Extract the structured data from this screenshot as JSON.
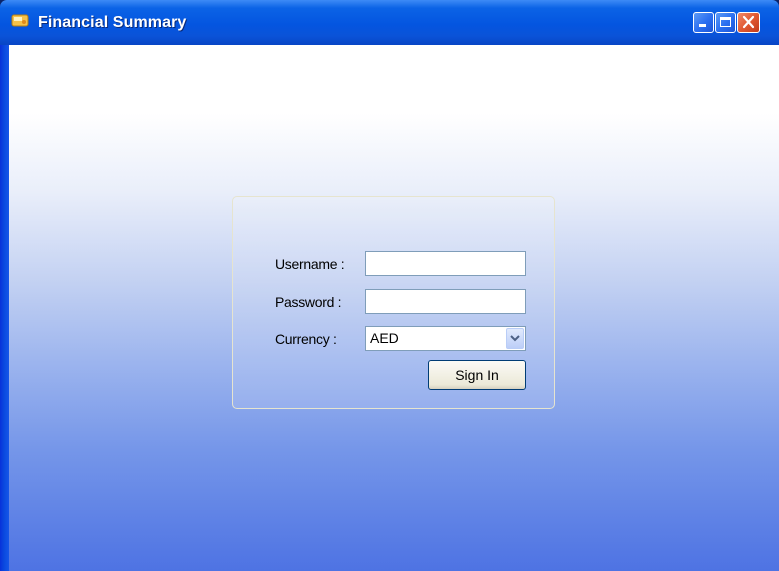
{
  "window": {
    "title": "Financial Summary"
  },
  "login": {
    "username_label": "Username :",
    "username_value": "",
    "password_label": "Password :",
    "password_value": "",
    "currency_label": "Currency :",
    "currency_selected": "AED",
    "sign_in_label": "Sign In"
  },
  "colors": {
    "titlebar": "#0455e0",
    "button_face": "#ece9d8",
    "border": "#7f9db9"
  }
}
